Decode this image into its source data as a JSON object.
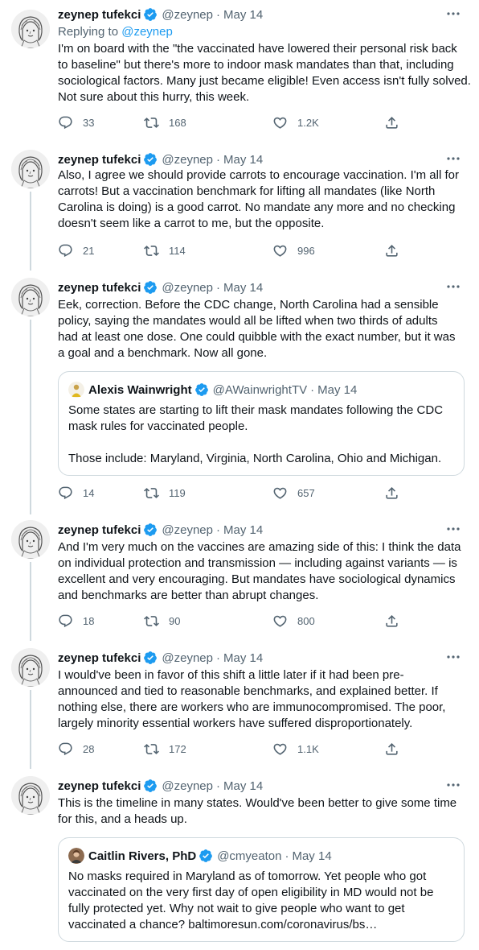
{
  "author": {
    "name": "zeynep tufekci",
    "handle": "@zeynep",
    "avatar": "sketch-portrait-avatar"
  },
  "icons": {
    "reply": "reply-icon",
    "retweet": "retweet-icon",
    "like": "heart-icon",
    "share": "share-icon",
    "more": "more-icon",
    "verified": "verified-badge-icon"
  },
  "colors": {
    "text": "#0f1419",
    "muted": "#536471",
    "accent": "#1d9bf0",
    "border": "#cfd9de"
  },
  "tweets": [
    {
      "separator": "·",
      "date": "May 14",
      "replying_label": "Replying to",
      "replying_to": "@zeynep",
      "lines": [
        "I'm on board with the \"the vaccinated have lowered their personal risk back",
        "to baseline\" but there's more to indoor mask mandates than that, including",
        "sociological factors. Many just became eligible! Even access isn't fully solved.",
        "Not sure about this hurry, this week."
      ],
      "replies": "33",
      "retweets": "168",
      "likes": "1.2K"
    },
    {
      "separator": "·",
      "date": "May 14",
      "lines": [
        "Also, I agree we should provide carrots to encourage vaccination. I'm all for",
        "carrots! But a vaccination benchmark for lifting all mandates (like North",
        "Carolina is doing) is a good carrot. No mandate any more and no checking",
        "doesn't seem like a carrot to me, but the opposite."
      ],
      "replies": "21",
      "retweets": "114",
      "likes": "996"
    },
    {
      "separator": "·",
      "date": "May 14",
      "lines": [
        "Eek, correction. Before the CDC change, North Carolina had a sensible",
        "policy, saying the mandates would all be lifted when two thirds of adults",
        "had at least one dose. One could quibble with the exact number, but it was",
        "a goal and a benchmark. Now all gone."
      ],
      "quote": {
        "name": "Alexis Wainwright",
        "handle": "@AWainwrightTV",
        "separator": "·",
        "date": "May 14",
        "lines": [
          "Some states are starting to lift their mask mandates following the CDC",
          "mask rules for vaccinated people.",
          "",
          "Those include: Maryland, Virginia, North Carolina, Ohio and Michigan."
        ]
      },
      "replies": "14",
      "retweets": "119",
      "likes": "657"
    },
    {
      "separator": "·",
      "date": "May 14",
      "lines": [
        "And I'm very much on the vaccines are amazing side of this: I think the data",
        "on individual protection and transmission — including against variants — is",
        "excellent and very encouraging. But mandates have sociological dynamics",
        "and benchmarks are better than abrupt changes."
      ],
      "replies": "18",
      "retweets": "90",
      "likes": "800"
    },
    {
      "separator": "·",
      "date": "May 14",
      "lines": [
        "I would've been in favor of this shift a little later if it had been pre-",
        "announced and tied to reasonable benchmarks, and explained better. If",
        "nothing else, there are workers who are immunocompromised. The poor,",
        "largely minority essential workers have suffered disproportionately."
      ],
      "replies": "28",
      "retweets": "172",
      "likes": "1.1K"
    },
    {
      "separator": "·",
      "date": "May 14",
      "lines": [
        "This is the timeline in many states. Would've been better to give some time",
        "for this, and a heads up."
      ],
      "quote": {
        "name": "Caitlin Rivers, PhD",
        "handle": "@cmyeaton",
        "separator": "·",
        "date": "May 14",
        "lines": [
          "No masks required in Maryland as of tomorrow. Yet people who got",
          "vaccinated on the very first day of open eligibility in MD would not be",
          "fully protected yet. Why not wait to give people who want to get",
          "vaccinated a chance? baltimoresun.com/coronavirus/bs…"
        ]
      }
    }
  ]
}
